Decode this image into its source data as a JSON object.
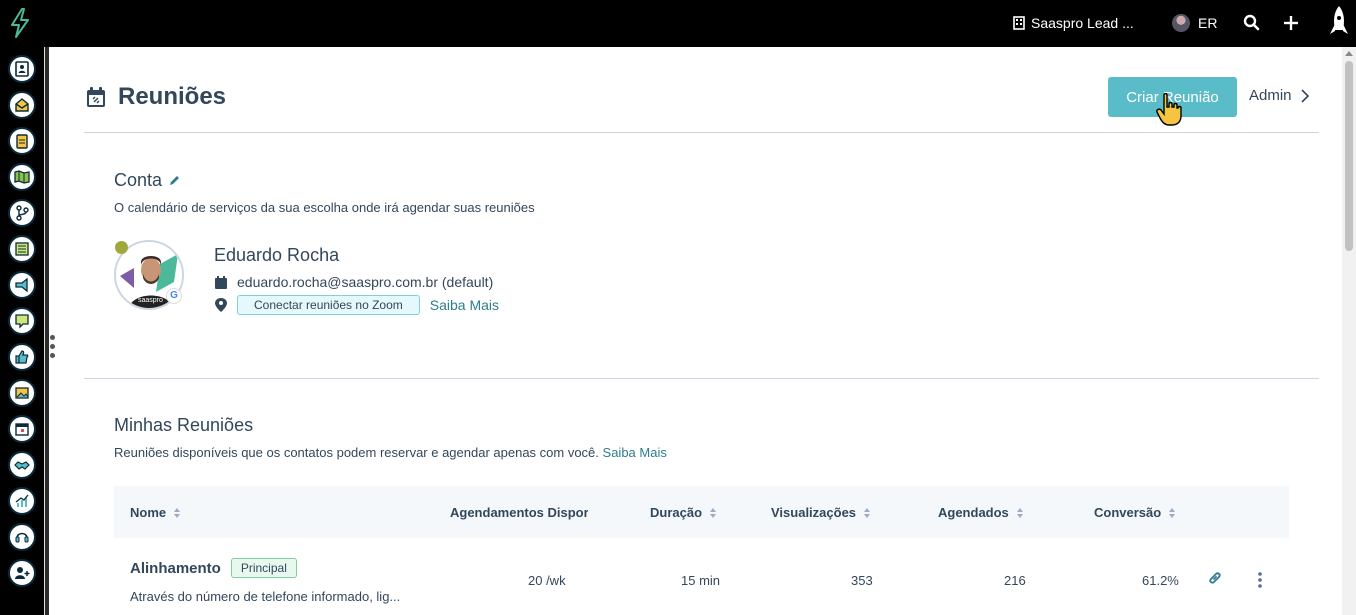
{
  "topbar": {
    "org_name": "Saaspro Lead ...",
    "user_initials": "ER",
    "icons": [
      "building-icon",
      "search-icon",
      "plus-icon",
      "rocket-icon"
    ]
  },
  "sidebar": {
    "items": [
      {
        "icon": "contacts-icon"
      },
      {
        "icon": "inbox-icon"
      },
      {
        "icon": "clipboard-icon"
      },
      {
        "icon": "map-icon"
      },
      {
        "icon": "workflow-icon"
      },
      {
        "icon": "list-icon"
      },
      {
        "icon": "megaphone-icon"
      },
      {
        "icon": "chat-icon"
      },
      {
        "icon": "thumbs-up-icon"
      },
      {
        "icon": "image-icon"
      },
      {
        "icon": "calendar-icon"
      },
      {
        "icon": "handshake-icon"
      },
      {
        "icon": "chart-icon"
      },
      {
        "icon": "headset-icon"
      },
      {
        "icon": "add-user-icon"
      }
    ]
  },
  "page": {
    "title": "Reuniões",
    "create_button": "Criar Reunião",
    "admin_label": "Admin"
  },
  "account": {
    "title": "Conta",
    "description": "O calendário de serviços da sua escolha onde irá agendar suas reuniões",
    "name": "Eduardo Rocha",
    "email": "eduardo.rocha@saaspro.com.br (default)",
    "zoom_button": "Conectar reuniões no Zoom",
    "learn_more": "Saiba Mais"
  },
  "meetings": {
    "title": "Minhas Reuniões",
    "description": "Reuniões disponíveis que os contatos podem reservar e agendar apenas com você.",
    "learn_more": "Saiba Mais",
    "columns": {
      "name": "Nome",
      "availability": "Agendamentos Dispor",
      "duration": "Duração",
      "views": "Visualizações",
      "booked": "Agendados",
      "conversion": "Conversão"
    },
    "rows": [
      {
        "name": "Alinhamento",
        "badge": "Principal",
        "description": "Através do número de telefone informado, lig...",
        "availability": "20 /wk",
        "duration": "15 min",
        "views": "353",
        "booked": "216",
        "conversion": "61.2%"
      }
    ]
  },
  "colors": {
    "accent": "#5bbcc9",
    "link": "#2e7d8e",
    "text": "#33475b",
    "logo": "#4bb99a"
  }
}
